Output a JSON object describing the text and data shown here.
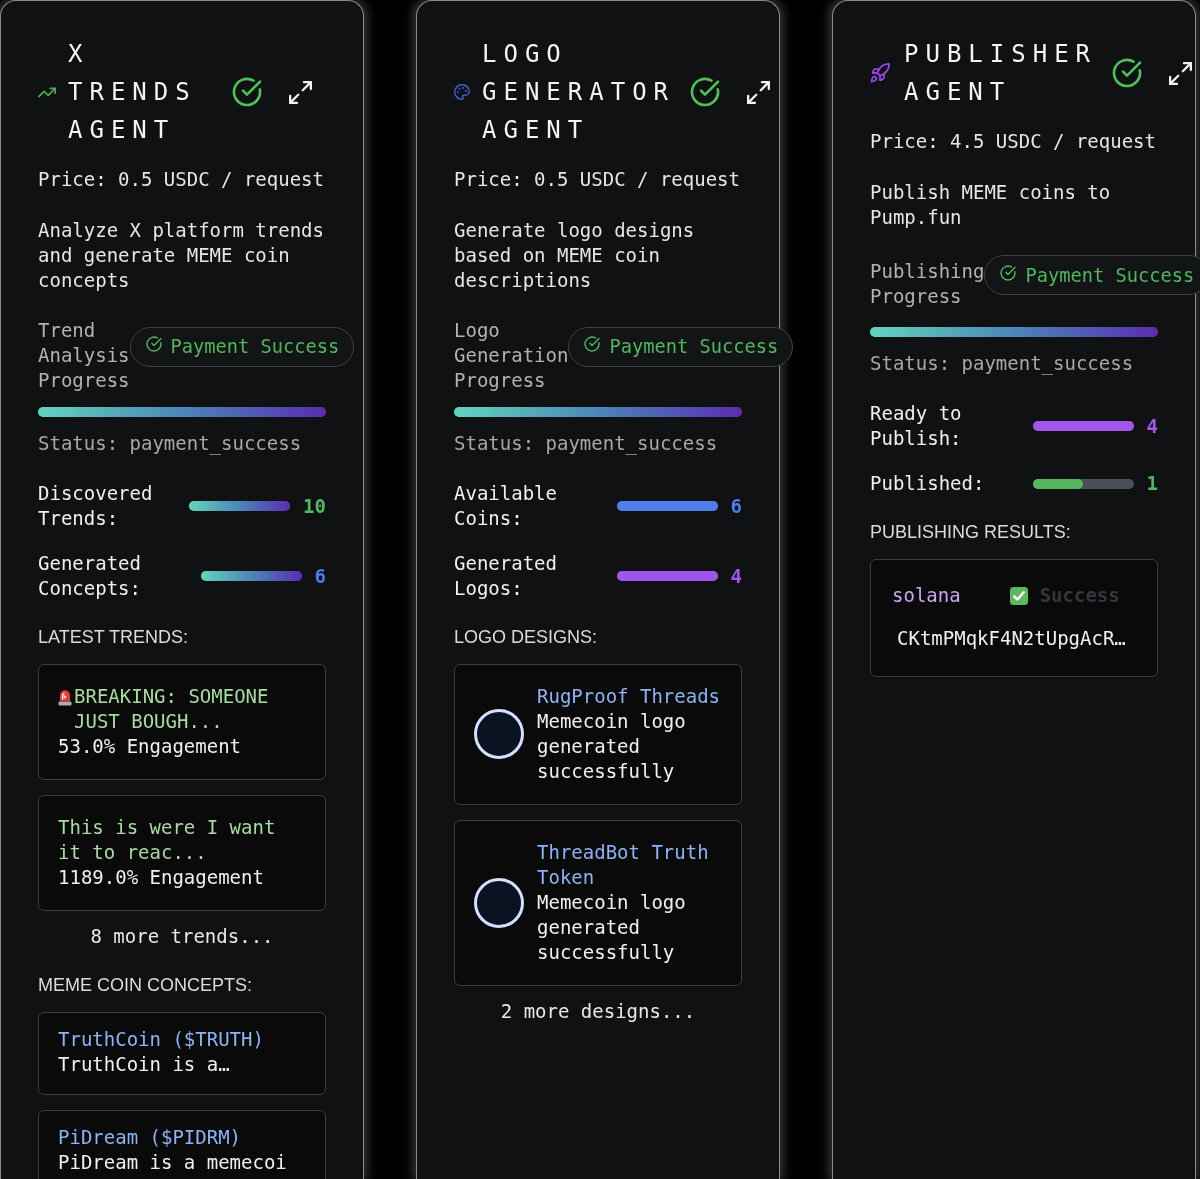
{
  "agents": [
    {
      "kind": "trends",
      "title": "X TRENDS AGENT",
      "price": "Price: 0.5 USDC / request",
      "description": "Analyze X platform trends and generate MEME coin concepts",
      "progress": {
        "label": "Trend Analysis Progress",
        "badge": "Payment Success",
        "level": 1,
        "status": "Status: payment_success"
      },
      "stats": [
        {
          "label": "Discovered Trends:",
          "value": "10",
          "kind": "gradient",
          "level": 1,
          "color": "#55b860"
        },
        {
          "label": "Generated Concepts:",
          "value": "6",
          "kind": "gradient",
          "level": 1,
          "color": "#4d7ee8"
        }
      ],
      "sections": [
        {
          "kind": "trends",
          "title": "LATEST TRENDS:",
          "items": [
            {
              "kind": "alert",
              "title": "BREAKING: SOMEONE JUST BOUGH...",
              "detail": "53.0% Engagement"
            },
            {
              "kind": "plain",
              "title": "This is were I want it to reac...",
              "detail": "1189.0% Engagement"
            }
          ],
          "more": "8 more trends..."
        },
        {
          "kind": "concepts",
          "title": "MEME COIN CONCEPTS:",
          "items": [
            {
              "title": "TruthCoin ($TRUTH)",
              "detail": "TruthCoin is a…"
            },
            {
              "title": "PiDream ($PIDRM)",
              "detail": "PiDream is a memecoi"
            }
          ]
        }
      ]
    },
    {
      "kind": "logo",
      "title": "LOGO GENERATOR AGENT",
      "price": "Price: 0.5 USDC / request",
      "description": "Generate logo designs based on MEME coin descriptions",
      "progress": {
        "label": "Logo Generation Progress",
        "badge": "Payment Success",
        "level": 1,
        "status": "Status: payment_success"
      },
      "stats": [
        {
          "label": "Available Coins:",
          "value": "6",
          "kind": "solid",
          "level": 1,
          "color": "#4d7ee8"
        },
        {
          "label": "Generated Logos:",
          "value": "4",
          "kind": "solid",
          "level": 1,
          "color": "#a056ec"
        }
      ],
      "sections": [
        {
          "kind": "logos",
          "title": "LOGO DESIGNS:",
          "items": [
            {
              "title": "RugProof Threads",
              "detail": "Memecoin logo generated successfully"
            },
            {
              "title": "ThreadBot Truth Token",
              "detail": "Memecoin logo generated successfully"
            }
          ],
          "more": "2 more designs..."
        }
      ]
    },
    {
      "kind": "publisher",
      "title": "PUBLISHER AGENT",
      "price": "Price: 4.5 USDC / request",
      "description": "Publish MEME coins to Pump.fun",
      "progress": {
        "label": "Publishing Progress",
        "badge": "Payment Success",
        "level": 1,
        "status": "Status: payment_success"
      },
      "stats": [
        {
          "label": "Ready to Publish:",
          "value": "4",
          "kind": "solid",
          "level": 1,
          "color": "#a056ec"
        },
        {
          "label": "Published:",
          "value": "1",
          "kind": "solid",
          "level": 0.5,
          "color": "#55b860"
        }
      ],
      "sections": [
        {
          "kind": "results",
          "title": "PUBLISHING RESULTS:",
          "items": [
            {
              "network": "solana",
              "status": "Success",
              "address": "CKtmPMqkF4N2tUpgAcR…"
            }
          ]
        }
      ]
    }
  ]
}
